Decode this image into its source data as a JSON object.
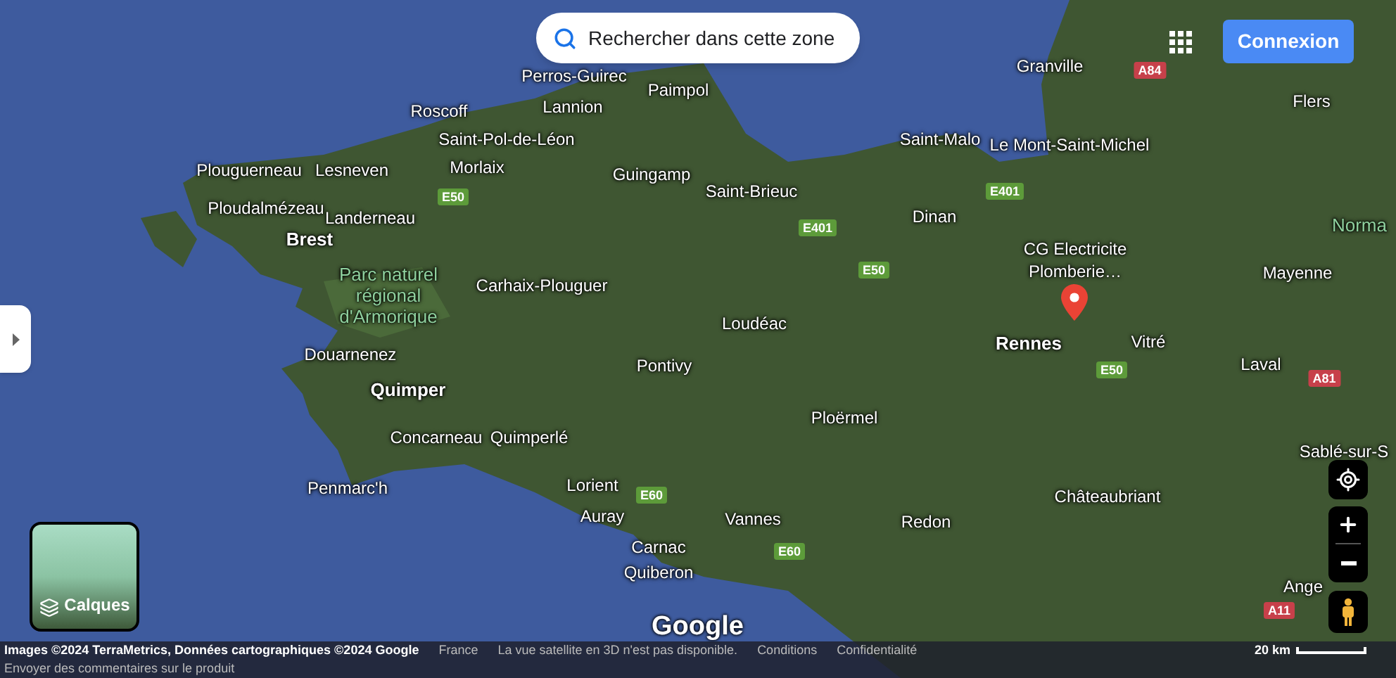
{
  "search_button": {
    "label": "Rechercher dans cette zone"
  },
  "sign_in_button": {
    "label": "Connexion"
  },
  "map_labels": [
    {
      "text": "Perros-Guirec",
      "kind": "city"
    },
    {
      "text": "Paimpol",
      "kind": "city"
    },
    {
      "text": "Granville",
      "kind": "city"
    },
    {
      "text": "Flers",
      "kind": "city"
    },
    {
      "text": "Roscoff",
      "kind": "city"
    },
    {
      "text": "Lannion",
      "kind": "city"
    },
    {
      "text": "Saint-Pol-de-Léon",
      "kind": "city"
    },
    {
      "text": "Saint-Malo",
      "kind": "city"
    },
    {
      "text": "Le Mont-Saint-Michel",
      "kind": "city"
    },
    {
      "text": "Plouguerneau",
      "kind": "city"
    },
    {
      "text": "Lesneven",
      "kind": "city"
    },
    {
      "text": "Morlaix",
      "kind": "city"
    },
    {
      "text": "Guingamp",
      "kind": "city"
    },
    {
      "text": "Saint-Brieuc",
      "kind": "city"
    },
    {
      "text": "Ploudalmézeau",
      "kind": "city"
    },
    {
      "text": "Landerneau",
      "kind": "city"
    },
    {
      "text": "Dinan",
      "kind": "city"
    },
    {
      "text": "Brest",
      "kind": "major"
    },
    {
      "text": "CG Electricite Plomberie…",
      "kind": "poi"
    },
    {
      "text": "Parc naturel régional d'Armorique",
      "kind": "park"
    },
    {
      "text": "Norma",
      "kind": "park"
    },
    {
      "text": "Mayenne",
      "kind": "city"
    },
    {
      "text": "Carhaix-Plouguer",
      "kind": "city"
    },
    {
      "text": "Loudéac",
      "kind": "city"
    },
    {
      "text": "Rennes",
      "kind": "major"
    },
    {
      "text": "Vitré",
      "kind": "city"
    },
    {
      "text": "Douarnenez",
      "kind": "city"
    },
    {
      "text": "Laval",
      "kind": "city"
    },
    {
      "text": "Pontivy",
      "kind": "city"
    },
    {
      "text": "Quimper",
      "kind": "major"
    },
    {
      "text": "Ploërmel",
      "kind": "city"
    },
    {
      "text": "Concarneau",
      "kind": "city"
    },
    {
      "text": "Quimperlé",
      "kind": "city"
    },
    {
      "text": "Sablé-sur-S",
      "kind": "city"
    },
    {
      "text": "Penmarc'h",
      "kind": "city"
    },
    {
      "text": "Lorient",
      "kind": "city"
    },
    {
      "text": "Châteaubriant",
      "kind": "city"
    },
    {
      "text": "Auray",
      "kind": "city"
    },
    {
      "text": "Vannes",
      "kind": "city"
    },
    {
      "text": "Redon",
      "kind": "city"
    },
    {
      "text": "Carnac",
      "kind": "city"
    },
    {
      "text": "Quiberon",
      "kind": "city"
    },
    {
      "text": "Ange",
      "kind": "city"
    }
  ],
  "road_shields": [
    {
      "text": "A84",
      "kind": "motorway"
    },
    {
      "text": "E401",
      "kind": "european"
    },
    {
      "text": "E50",
      "kind": "european"
    },
    {
      "text": "E401",
      "kind": "european"
    },
    {
      "text": "E50",
      "kind": "european"
    },
    {
      "text": "E50",
      "kind": "european"
    },
    {
      "text": "A81",
      "kind": "motorway"
    },
    {
      "text": "E60",
      "kind": "european"
    },
    {
      "text": "E60",
      "kind": "european"
    },
    {
      "text": "A11",
      "kind": "motorway"
    }
  ],
  "layers_button": {
    "label": "Calques"
  },
  "logo": "Google",
  "footer": {
    "attribution": "Images ©2024 TerraMetrics, Données cartographiques ©2024 Google",
    "country": "France",
    "notice": "La vue satellite en 3D n'est pas disponible.",
    "links": [
      "Conditions",
      "Confidentialité"
    ],
    "scale": "20 km",
    "feedback": "Envoyer des commentaires sur le produit"
  }
}
